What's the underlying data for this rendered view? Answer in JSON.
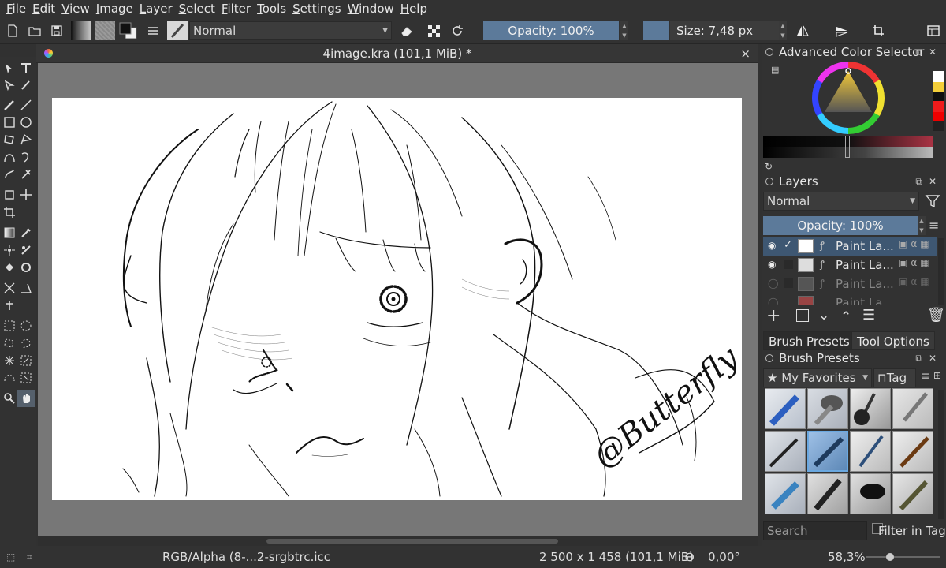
{
  "menu": [
    "File",
    "Edit",
    "View",
    "Image",
    "Layer",
    "Select",
    "Filter",
    "Tools",
    "Settings",
    "Window",
    "Help"
  ],
  "toolbar": {
    "blend_mode": "Normal",
    "opacity_label": "Opacity: 100%",
    "size_label": "Size: 7,48 px"
  },
  "document": {
    "tab_title": "4image.kra (101,1 MiB) *",
    "close": "×"
  },
  "canvas": {
    "signature": "@Butterfly"
  },
  "color_selector": {
    "title": "Advanced Color Selector"
  },
  "layers": {
    "title": "Layers",
    "blend_mode": "Normal",
    "opacity_label": "Opacity:  100%",
    "items": [
      {
        "name": "Paint La...",
        "visible": true,
        "selected": true
      },
      {
        "name": "Paint La...",
        "visible": true,
        "selected": false
      },
      {
        "name": "Paint La...",
        "visible": false,
        "selected": false
      },
      {
        "name": "Paint La...",
        "visible": false,
        "selected": false
      }
    ]
  },
  "dock_tabs": {
    "brush_presets": "Brush Presets",
    "tool_options": "Tool Options"
  },
  "brush_presets": {
    "title": "Brush Presets",
    "tag": "My Favorites",
    "tag_button": "Tag",
    "search_placeholder": "Search",
    "filter_label": "Filter in Tag"
  },
  "status": {
    "color_profile": "RGB/Alpha (8-...2-srgbtrc.icc",
    "dimensions": "2 500 x 1 458 (101,1 MiB)",
    "rotation": "0,00°",
    "zoom": "58,3%"
  },
  "colors": {
    "accent": "#5c7a9a",
    "selected_layer": "#3e5772",
    "panel_bg": "#323232",
    "canvas_surround": "#777777"
  }
}
